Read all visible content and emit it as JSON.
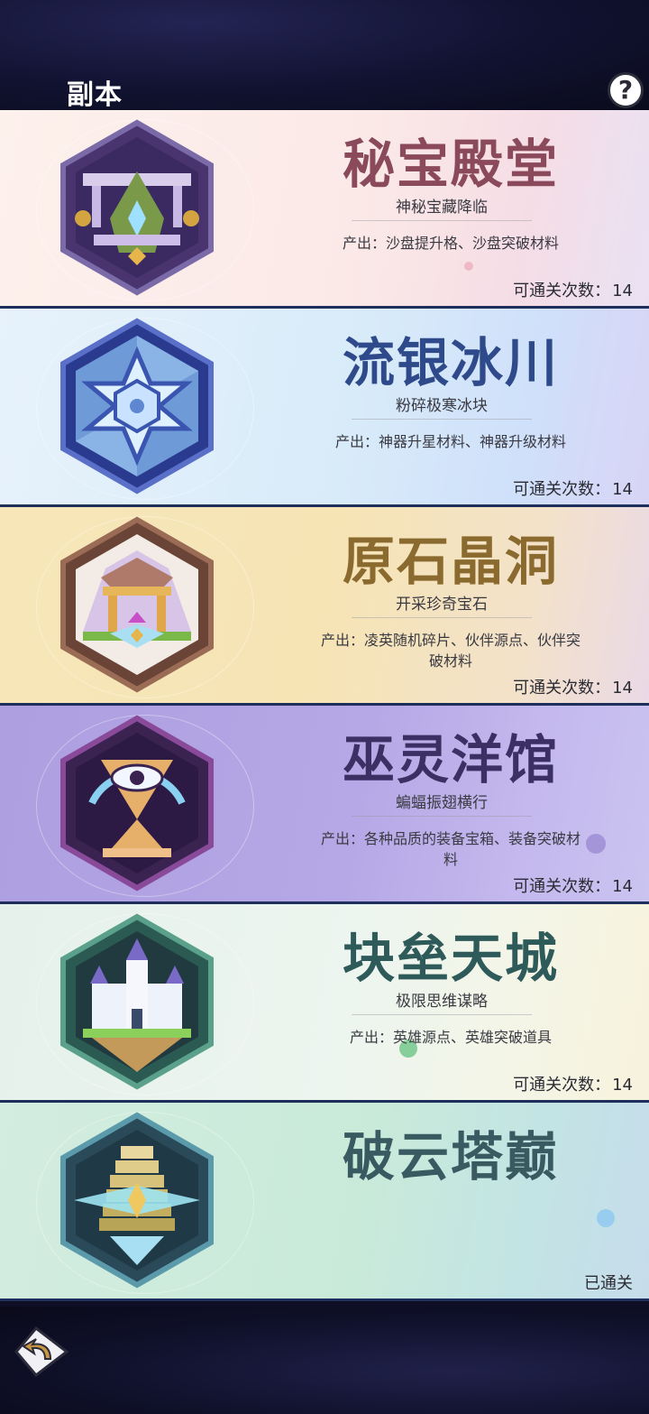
{
  "header": {
    "title": "副本"
  },
  "dungeons": [
    {
      "name": "秘宝殿堂",
      "subtitle": "神秘宝藏降临",
      "output": "产出：沙盘提升格、沙盘突破材料",
      "clear_label": "可通关次数：",
      "clear_count": "14",
      "name_color": "#8a4a5c",
      "icon": "treasure-hall-icon"
    },
    {
      "name": "流银冰川",
      "subtitle": "粉碎极寒冰块",
      "output": "产出：神器升星材料、神器升级材料",
      "clear_label": "可通关次数：",
      "clear_count": "14",
      "name_color": "#2f4a8a",
      "icon": "glacier-snowflake-icon"
    },
    {
      "name": "原石晶洞",
      "subtitle": "开采珍奇宝石",
      "output": "产出：凌英随机碎片、伙伴源点、伙伴突破材料",
      "clear_label": "可通关次数：",
      "clear_count": "14",
      "name_color": "#8a6a2e",
      "icon": "crystal-cave-icon"
    },
    {
      "name": "巫灵洋馆",
      "subtitle": "蝙蝠振翅横行",
      "output": "产出：各种品质的装备宝箱、装备突破材料",
      "clear_label": "可通关次数：",
      "clear_count": "14",
      "name_color": "#3b2f63",
      "icon": "eye-hourglass-icon"
    },
    {
      "name": "块垒天城",
      "subtitle": "极限思维谋略",
      "output": "产出：英雄源点、英雄突破道具",
      "clear_label": "可通关次数：",
      "clear_count": "14",
      "name_color": "#2f5a5a",
      "icon": "sky-castle-icon"
    },
    {
      "name": "破云塔巅",
      "status": "已通关",
      "name_color": "#3a5a62",
      "icon": "cloud-tower-icon"
    }
  ],
  "footer": {
    "back_icon": "back-arrow-icon"
  }
}
